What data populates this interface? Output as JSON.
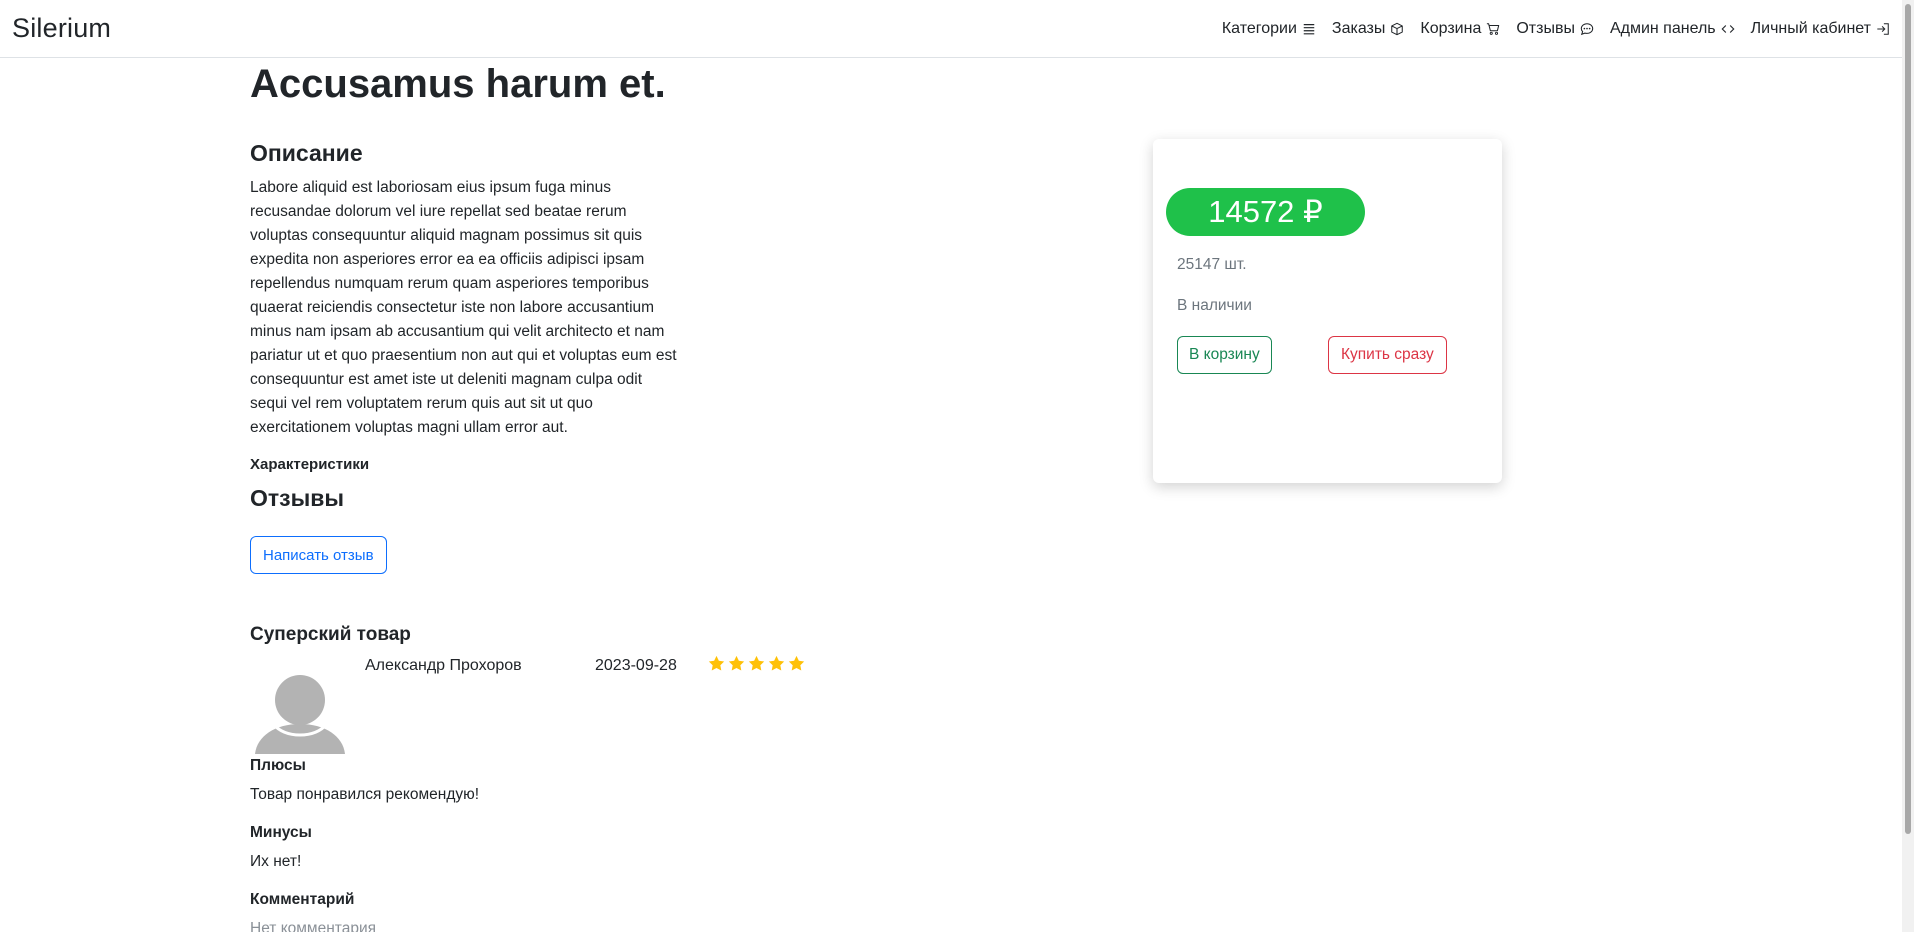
{
  "navbar": {
    "brand": "Silerium",
    "items": [
      {
        "label": "Категории",
        "icon": "list-icon"
      },
      {
        "label": "Заказы",
        "icon": "box-icon"
      },
      {
        "label": "Корзина",
        "icon": "cart-icon"
      },
      {
        "label": "Отзывы",
        "icon": "chat-icon"
      },
      {
        "label": "Админ панель",
        "icon": "code-icon"
      },
      {
        "label": "Личный кабинет",
        "icon": "login-icon"
      }
    ]
  },
  "product": {
    "title": "Accusamus harum et.",
    "description_heading": "Описание",
    "description": "Labore aliquid est laboriosam eius ipsum fuga minus recusandae dolorum vel iure repellat sed beatae rerum voluptas consequuntur aliquid magnam possimus sit quis expedita non asperiores error ea ea officiis adipisci ipsam repellendus numquam rerum quam asperiores temporibus quaerat reiciendis consectetur iste non labore accusantium minus nam ipsam ab accusantium qui velit architecto et nam pariatur ut et quo praesentium non aut qui et voluptas eum est consequuntur est amet iste ut deleniti magnam culpa odit sequi vel rem voluptatem rerum quis aut sit ut quo exercitationem voluptas magni ullam error aut.",
    "specs_label": "Характеристики"
  },
  "card": {
    "price": "14572 ₽",
    "quantity": "25147 шт.",
    "stock": "В наличии",
    "cart_label": "В корзину",
    "buy_label": "Купить сразу",
    "price_color": "#1fc14a"
  },
  "reviews": {
    "heading": "Отзывы",
    "write_label": "Написать отзыв",
    "items": [
      {
        "title": "Суперский товар",
        "author": "Александр Прохоров",
        "date": "2023-09-28",
        "rating": 5,
        "pros_label": "Плюсы",
        "pros": "Товар понравился рекомендую!",
        "cons_label": "Минусы",
        "cons": "Их нет!",
        "comment_label": "Комментарий",
        "comment": "Нет комментария"
      }
    ]
  },
  "colors": {
    "star": "#ffc107",
    "primary": "#0d6efd",
    "success": "#198754",
    "danger": "#dc3545"
  }
}
